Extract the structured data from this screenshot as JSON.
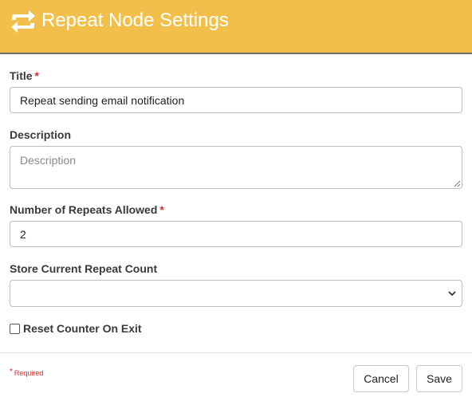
{
  "header": {
    "icon": "repeat-arrows-icon",
    "title": "Repeat Node Settings",
    "background": "#f2c04a"
  },
  "form": {
    "title_label": "Title",
    "title_value": "Repeat sending email notification",
    "description_label": "Description",
    "description_placeholder": "Description",
    "repeats_label": "Number of Repeats Allowed",
    "repeats_value": "2",
    "store_label": "Store Current Repeat Count",
    "store_value": "",
    "reset_label": "Reset Counter On Exit",
    "reset_checked": false,
    "required_marker": "*"
  },
  "footer": {
    "required_star": "*",
    "required_text": "Required",
    "cancel_label": "Cancel",
    "save_label": "Save"
  },
  "colors": {
    "accent": "#f2c04a",
    "required": "#d0312d"
  }
}
